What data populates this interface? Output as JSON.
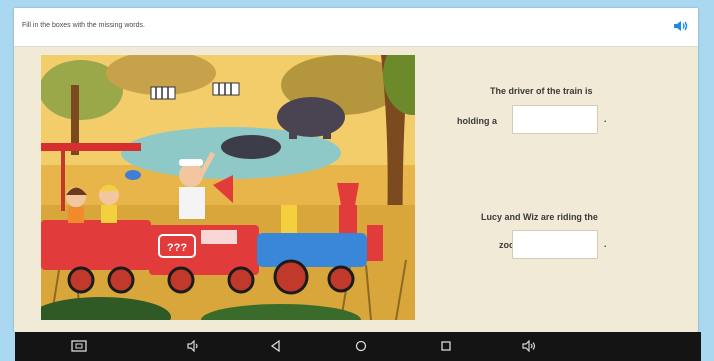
{
  "instruction": "Fill in the boxes with the missing words.",
  "questions": [
    {
      "line1": "The driver of the train is",
      "prefix": "holding a",
      "answer_value": "",
      "suffix": "."
    },
    {
      "line1": "Lucy and Wiz are riding the",
      "prefix": "zoo",
      "answer_value": "",
      "suffix": "."
    }
  ],
  "scene": {
    "train_sign": "???"
  },
  "icons": {
    "speaker": "speaker-icon",
    "screenshot": "screenshot-icon",
    "volume_down": "volume-down-icon",
    "back": "back-icon",
    "home": "home-icon",
    "recents": "recents-icon",
    "volume_up": "volume-up-icon"
  },
  "colors": {
    "page_bg": "#a9d8f0",
    "panel_bg": "#f0ead7",
    "nav_bg": "#141414",
    "accent_blue": "#1e88e5"
  }
}
